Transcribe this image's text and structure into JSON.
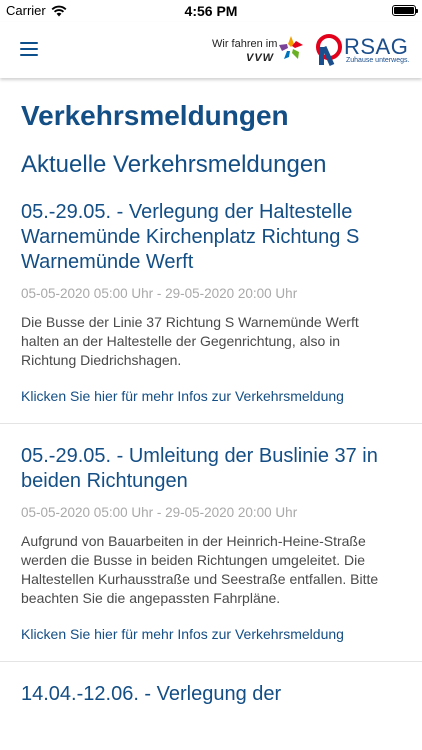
{
  "status": {
    "carrier": "Carrier",
    "time": "4:56 PM",
    "battery_level": 1.0
  },
  "header": {
    "vvw_line1": "Wir fahren im",
    "vvw_line2": "VVW",
    "rsag_name": "RSAG",
    "rsag_claim": "Zuhause unterwegs.",
    "brand_color": "#134e85"
  },
  "page": {
    "title": "Verkehrsmeldungen",
    "section": "Aktuelle Verkehrsmeldungen"
  },
  "articles": [
    {
      "title": "05.-29.05. - Verlegung der Haltestelle Warnemünde Kirchenplatz Richtung S Warnemünde Werft",
      "date": "05-05-2020 05:00 Uhr - 29-05-2020 20:00 Uhr",
      "body": "Die Busse der Linie 37 Richtung S Warnemünde Werft halten an der Haltestelle der Gegenrichtung, also in Richtung Diedrichshagen.",
      "link": "Klicken Sie hier für mehr Infos zur Verkehrsmeldung"
    },
    {
      "title": "05.-29.05. - Umleitung der Buslinie 37 in beiden Richtungen",
      "date": "05-05-2020 05:00 Uhr - 29-05-2020 20:00 Uhr",
      "body": "Aufgrund von Bauarbeiten in der Heinrich-Heine-Straße werden die Busse in beiden Richtungen umgeleitet. Die Haltestellen Kurhausstraße und Seestraße entfallen. Bitte beachten Sie die angepassten Fahrpläne.",
      "link": "Klicken Sie hier für mehr Infos zur Verkehrsmeldung"
    },
    {
      "title": "14.04.-12.06. - Verlegung der"
    }
  ]
}
